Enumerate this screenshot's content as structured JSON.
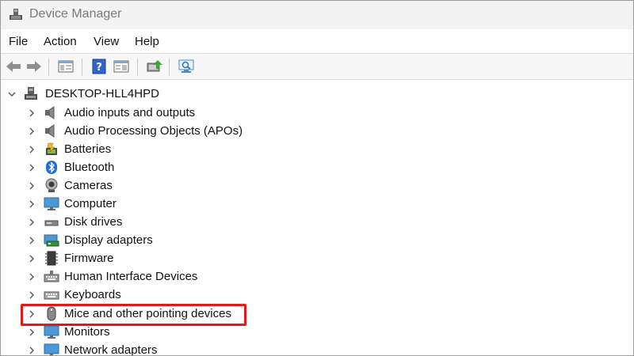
{
  "window": {
    "title": "Device Manager"
  },
  "menu": [
    "File",
    "Action",
    "View",
    "Help"
  ],
  "toolbar": {
    "icons": [
      "back-arrow-icon",
      "forward-arrow-icon",
      "properties-panel-icon",
      "help-icon",
      "view-panel-icon",
      "update-driver-icon",
      "scan-hardware-icon"
    ]
  },
  "tree": {
    "root": "DESKTOP-HLL4HPD",
    "items": [
      "Audio inputs and outputs",
      "Audio Processing Objects (APOs)",
      "Batteries",
      "Bluetooth",
      "Cameras",
      "Computer",
      "Disk drives",
      "Display adapters",
      "Firmware",
      "Human Interface Devices",
      "Keyboards",
      "Mice and other pointing devices",
      "Monitors",
      "Network adapters"
    ]
  },
  "colors": {
    "highlight": "#e01a1a",
    "bluetooth": "#1f6fd6",
    "monitor": "#4a9ad8"
  }
}
